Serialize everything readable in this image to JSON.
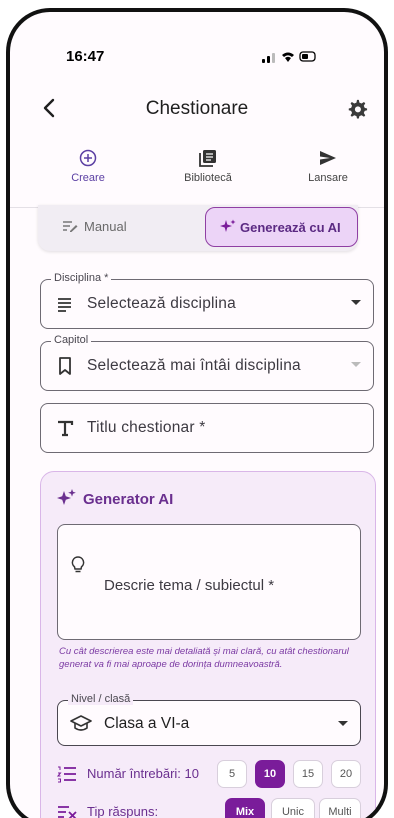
{
  "status": {
    "time": "16:47"
  },
  "appbar": {
    "title": "Chestionare"
  },
  "tabs": [
    {
      "label": "Creare",
      "icon": "add-circle-icon",
      "active": true
    },
    {
      "label": "Bibliotecă",
      "icon": "library-icon",
      "active": false
    },
    {
      "label": "Lansare",
      "icon": "send-icon",
      "active": false
    }
  ],
  "mode": {
    "manual_label": "Manual",
    "ai_label": "Generează cu AI",
    "selected": "ai"
  },
  "form": {
    "discipline": {
      "label": "Disciplina *",
      "placeholder": "Selectează disciplina"
    },
    "chapter": {
      "label": "Capitol",
      "placeholder": "Selectează mai întâi disciplina"
    },
    "title": {
      "placeholder": "Titlu chestionar *"
    }
  },
  "ai": {
    "heading": "Generator AI",
    "description_placeholder": "Descrie tema / subiectul *",
    "hint": "Cu cât descrierea este mai detaliată și mai clară, cu atât chestionarul generat va fi mai aproape de dorința dumneavoastră.",
    "level": {
      "label": "Nivel / clasă",
      "value": "Clasa a VI-a"
    },
    "questions": {
      "label": "Număr întrebări: 10",
      "options": [
        "5",
        "10",
        "15",
        "20"
      ],
      "selected": "10"
    },
    "answer_type": {
      "label": "Tip răspuns:",
      "options": [
        "Mix",
        "Unic",
        "Multi"
      ],
      "selected": "Mix"
    }
  },
  "colors": {
    "accent": "#7a1c9a",
    "accent_light": "#ecd4f7",
    "panel": "#f6ebf9"
  }
}
